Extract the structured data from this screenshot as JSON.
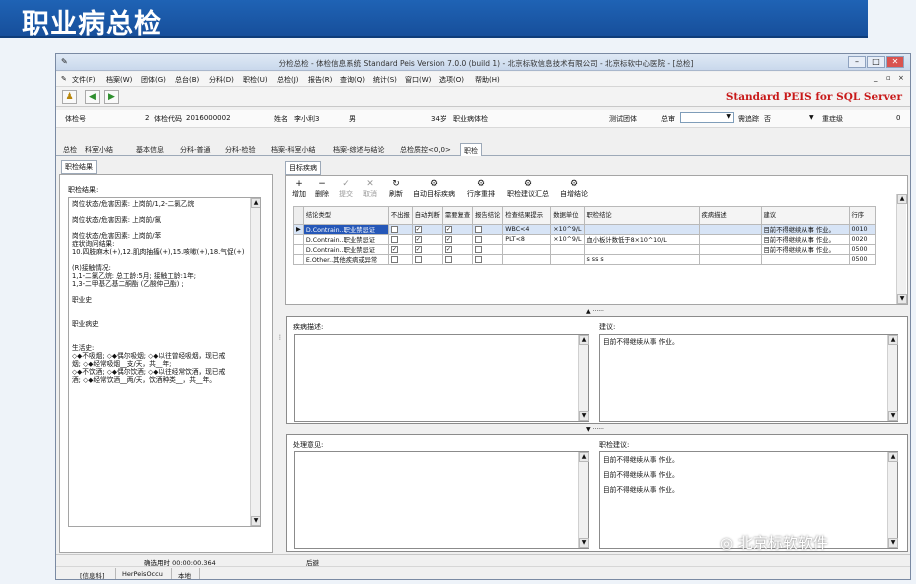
{
  "slide": {
    "title": "职业病总检"
  },
  "window": {
    "title": "分检总检 - 体检信息系统 Standard Peis Version 7.0.0 (build 1) - 北京标软信息技术有限公司 - 北京标软中心医院 - [总检]",
    "min": "–",
    "max": "□",
    "close": "✕"
  },
  "menu": [
    "文件(F)",
    "档案(W)",
    "团体(G)",
    "总台(B)",
    "分科(D)",
    "职检(U)",
    "总检(J)",
    "报告(R)",
    "查询(Q)",
    "统计(S)",
    "窗口(W)",
    "选项(O)",
    "帮助(H)"
  ],
  "brand": {
    "text": "Standard PEIS for SQL Server",
    "color": "#c81919"
  },
  "info": {
    "exam_no_label": "体检号",
    "exam_no": "2",
    "code_label": "体检代码",
    "code": "2016000002",
    "name_label": "姓名",
    "name": "李小利3",
    "sex": "男",
    "age": "34岁",
    "type": "职业病体检",
    "test_group_label": "测试团体",
    "review_label": "总审",
    "tracking_label": "需追踪",
    "tracking_value": "否",
    "severity_label": "重症级",
    "severity_value": "0"
  },
  "tabs": [
    "总检",
    "科室小结",
    "基本信息",
    "分科-普通",
    "分科-检验",
    "档案-科室小结",
    "档案-综述与结论",
    "总检质控<0,0>",
    "职检"
  ],
  "left": {
    "tab": "职检结果",
    "label": "职检结果:",
    "text": "岗位状态/危害因素: 上岗前/1,2-二氯乙烷\n\n岗位状态/危害因素: 上岗前/氯\n\n岗位状态/危害因素: 上岗前/苯\n症状询问结果:\n10.四肢麻木(+),12.肌肉抽搐(+),15.咳嗽(+),18.气促(+)\n\n(R)接触情况:\n1,1-二氯乙烷: 总工龄:5月; 接触工龄:1年;\n1,3-二甲基乙基二酮酯 (乙酸仲己酯) ;\n\n职业史\n\n\n职业病史\n\n\n生活史:\n◇◆不吸烟; ◇◆偶尔吸烟; ◇◆以往曾经吸烟，现已戒\n烟; ◇◆经常吸烟__支/天，共__年;\n◇◆不饮酒; ◇◆偶尔饮酒; ◇◆以往经常饮酒，现已戒\n酒; ◇◆经常饮酒__两/天，饮酒种类__，共__年。"
  },
  "right": {
    "tab": "目标疾病",
    "tools": [
      {
        "icon": "+",
        "label": "增加"
      },
      {
        "icon": "−",
        "label": "删除"
      },
      {
        "icon": "✓",
        "label": "提交"
      },
      {
        "icon": "✕",
        "label": "取消"
      },
      {
        "icon": "↻",
        "label": "刷新"
      },
      {
        "icon": "⚙",
        "label": "自动目标疾病"
      },
      {
        "icon": "⚙",
        "label": "行序重排"
      },
      {
        "icon": "⚙",
        "label": "职检建议汇总"
      },
      {
        "icon": "⚙",
        "label": "自增结论"
      }
    ],
    "headers": [
      "结论类型",
      "不出报",
      "自动判断",
      "需要复查",
      "报告结论",
      "检查结果提示",
      "数据单位",
      "职检结论",
      "疾病描述",
      "建议",
      "行序"
    ],
    "rows": [
      {
        "type": "D.Contrain..职业禁忌证",
        "c1": "",
        "c2": "✓",
        "c3": "✓",
        "c4": "",
        "hint": "WBC<4",
        "unit": "×10^9/L",
        "concl": "",
        "disease": "",
        "advice": "目前不得继续从事 作业。",
        "order": "0010"
      },
      {
        "type": "D.Contrain..职业禁忌证",
        "c1": "",
        "c2": "✓",
        "c3": "✓",
        "c4": "",
        "hint": "PLT<8",
        "unit": "×10^9/L",
        "concl": "血小板计数低于8×10^10/L",
        "disease": "",
        "advice": "目前不得继续从事 作业。",
        "order": "0020"
      },
      {
        "type": "D.Contrain..职业禁忌证",
        "c1": "✓",
        "c2": "✓",
        "c3": "✓",
        "c4": "",
        "hint": "",
        "unit": "",
        "concl": "",
        "disease": "",
        "advice": "目前不得继续从事 作业。",
        "order": "0500"
      },
      {
        "type": "E.Other..其他疾病或异常",
        "c1": "",
        "c2": "",
        "c3": "",
        "c4": "",
        "hint": "",
        "unit": "",
        "concl": "s ss s",
        "disease": "",
        "advice": "",
        "order": "0500"
      }
    ],
    "disease_label": "疾病描述:",
    "advice_label": "建议:",
    "advice_text": "目前不得继续从事 作业。",
    "handle_label": "处理意见:",
    "occ_label": "职检建议:",
    "occ_lines": [
      "目前不得继续从事 作业。",
      "目前不得继续从事 作业。",
      "目前不得继续从事 作业。"
    ]
  },
  "status": {
    "time": "确选用时 00:00:00.364",
    "right": "后避"
  },
  "status2": [
    "[信息科]",
    "HerPeisOccu",
    "本地"
  ],
  "watermark": "北京标软软件"
}
